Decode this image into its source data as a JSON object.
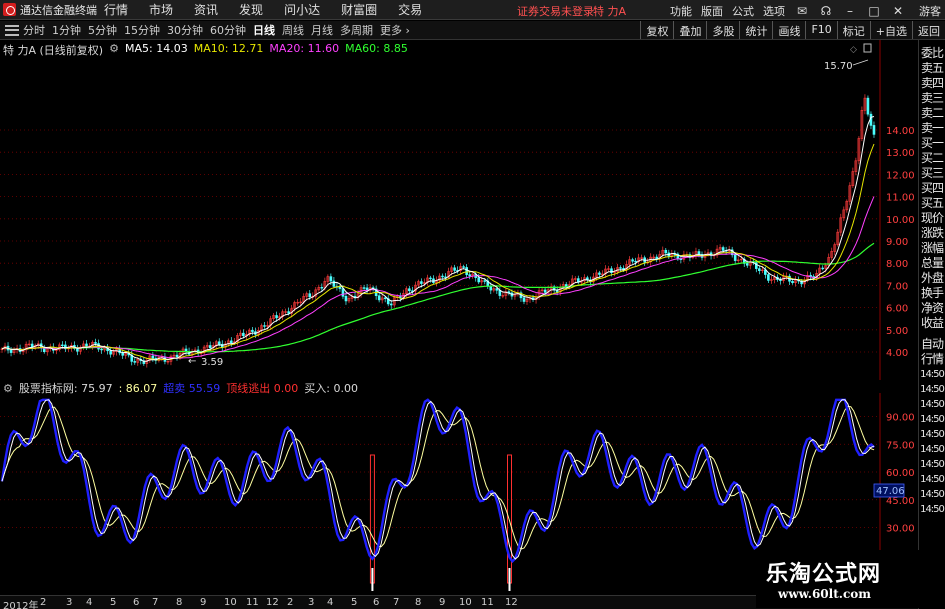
{
  "app": {
    "title": "通达信金融终端",
    "login_status": "证券交易未登录",
    "stock_name": "特 力A"
  },
  "menu": [
    "行情",
    "市场",
    "资讯",
    "发现",
    "问小达",
    "财富圈",
    "交易"
  ],
  "top_right": [
    "功能",
    "版面",
    "公式",
    "选项"
  ],
  "guest_label": "游客",
  "periods": [
    "分时",
    "1分钟",
    "5分钟",
    "15分钟",
    "30分钟",
    "60分钟",
    "日线",
    "周线",
    "月线",
    "多周期",
    "更多"
  ],
  "active_period": "日线",
  "toolbar_right": [
    "复权",
    "叠加",
    "多股",
    "统计",
    "画线",
    "F10",
    "标记",
    "+自选",
    "返回"
  ],
  "main_panel": {
    "title": "特 力A (日线前复权)",
    "ma5": "MA5: 14.03",
    "ma10": "MA10: 12.71",
    "ma20": "MA20: 11.60",
    "ma60": "MA60: 8.85",
    "high_label": "15.70",
    "low_label": "3.59",
    "y_ticks": [
      "14.00",
      "13.00",
      "12.00",
      "11.00",
      "10.00",
      "9.00",
      "8.00",
      "7.00",
      "6.00",
      "5.00",
      "4.00"
    ],
    "colors": {
      "ma5": "#ffffff",
      "ma10": "#e6e600",
      "ma20": "#ff40ff",
      "ma60": "#30ff30",
      "up": "#ff3c3c",
      "down": "#4cffff"
    }
  },
  "sub_panel": {
    "title": "股票指标网",
    "v1": ": 75.97",
    "v2": ": 86.07",
    "v3": "超卖 55.59",
    "v4": "顶线逃出 0.00",
    "v5": "买入: 0.00",
    "y_ticks": [
      "90.00",
      "75.00",
      "60.00",
      "45.00",
      "30.00"
    ],
    "current_value": "47.06",
    "colors": {
      "fast": "#2020ff",
      "slow": "#ffffa0",
      "white": "#ffffff",
      "signal": "#ff3030"
    }
  },
  "side_tabs": [
    "委比",
    "卖五",
    "卖四",
    "卖三",
    "卖二",
    "卖一",
    "买一",
    "买二",
    "买三",
    "买四",
    "买五",
    "现价",
    "涨跌",
    "涨幅",
    "总量",
    "外盘",
    "换手",
    "净资",
    "收益"
  ],
  "side_tabs_lower": [
    "自动",
    "行情"
  ],
  "side_times": [
    "14:50",
    "14:50",
    "14:50",
    "14:50",
    "14:50",
    "14:50",
    "14:50",
    "14:50",
    "14:50",
    "14:50"
  ],
  "date_axis": [
    "2012年",
    "2",
    "3",
    "4",
    "5",
    "6",
    "7",
    "8",
    "9",
    "10",
    "11",
    "12",
    "2",
    "3",
    "4",
    "5",
    "6",
    "7",
    "8",
    "9",
    "10",
    "11",
    "12"
  ],
  "watermark": {
    "title": "乐淘公式网",
    "url": "www.60lt.com"
  }
}
